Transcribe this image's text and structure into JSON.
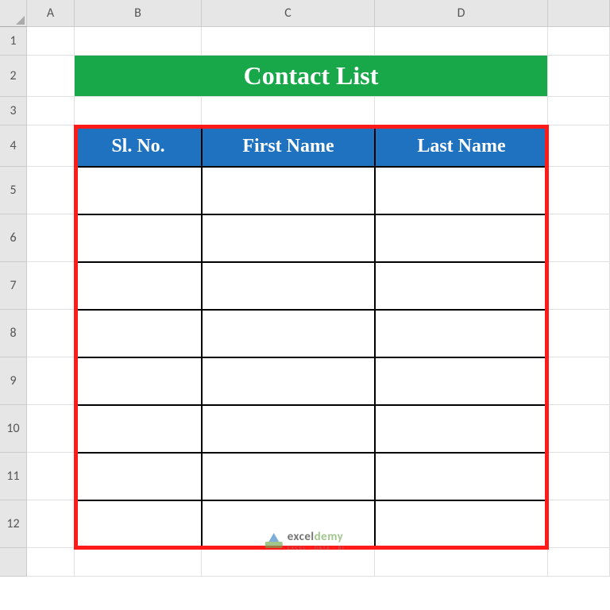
{
  "cols": [
    "A",
    "B",
    "C",
    "D"
  ],
  "rows": [
    "1",
    "2",
    "3",
    "4",
    "5",
    "6",
    "7",
    "8",
    "9",
    "10",
    "11",
    "12"
  ],
  "title": "Contact List",
  "headers": {
    "b4": "Sl. No.",
    "c4": "First Name",
    "d4": "Last Name"
  },
  "table_rows": [
    {
      "sl": "",
      "first": "",
      "last": ""
    },
    {
      "sl": "",
      "first": "",
      "last": ""
    },
    {
      "sl": "",
      "first": "",
      "last": ""
    },
    {
      "sl": "",
      "first": "",
      "last": ""
    },
    {
      "sl": "",
      "first": "",
      "last": ""
    },
    {
      "sl": "",
      "first": "",
      "last": ""
    },
    {
      "sl": "",
      "first": "",
      "last": ""
    },
    {
      "sl": "",
      "first": "",
      "last": ""
    }
  ],
  "watermark": {
    "brand1": "excel",
    "brand2": "demy",
    "tag": "EXCEL · DATA · BI"
  }
}
